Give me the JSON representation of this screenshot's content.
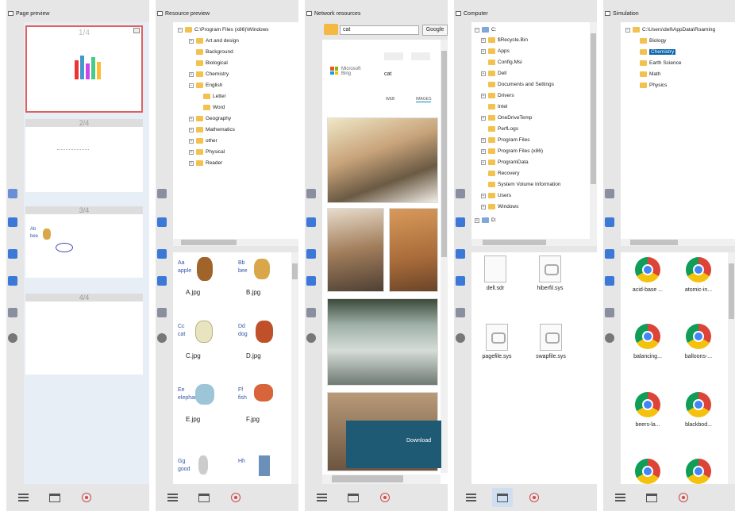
{
  "panels": {
    "page_preview": {
      "title": "Page preview",
      "pages": [
        "1/4",
        "2/4",
        "3/4",
        "4/4"
      ],
      "page3_text": {
        "line1": "Ab",
        "line2": "bee"
      }
    },
    "resource_preview": {
      "title": "Resource preview",
      "tree_root": "C:\\Program Files (x86)\\Windows",
      "tree": [
        "Art and design",
        "Background",
        "Biological",
        "Chemistry",
        "English",
        "Letter",
        "Word",
        "Geography",
        "Mathematics",
        "other",
        "Physical",
        "Reader"
      ],
      "items": [
        {
          "caption": "A.jpg",
          "word": "apple",
          "letter": "Aa"
        },
        {
          "caption": "B.jpg",
          "word": "bee",
          "letter": "Bb"
        },
        {
          "caption": "C.jpg",
          "word": "cat",
          "letter": "Cc"
        },
        {
          "caption": "D.jpg",
          "word": "dog",
          "letter": "Dd"
        },
        {
          "caption": "E.jpg",
          "word": "elephant",
          "letter": "Ee"
        },
        {
          "caption": "F.jpg",
          "word": "fish",
          "letter": "Ff"
        },
        {
          "word": "good",
          "letter": "Gg"
        },
        {
          "letter": "Hh"
        }
      ]
    },
    "network_resources": {
      "title": "Network resources",
      "search_value": "cat",
      "search_button": "Google",
      "bing_label": "Microsoft Bing",
      "bing_query": "cat",
      "tabs": [
        "WEB",
        "IMAGES"
      ],
      "download_label": "Download"
    },
    "computer": {
      "title": "Computer",
      "drive": "C:",
      "tree": [
        "$Recycle.Bin",
        "Apps",
        "Config.Msi",
        "Dell",
        "Documents and Settings",
        "Drivers",
        "Intel",
        "OneDriveTemp",
        "PerfLogs",
        "Program Files",
        "Program Files (x86)",
        "ProgramData",
        "Recovery",
        "System Volume Information",
        "Users",
        "Windows",
        "D:"
      ],
      "files": [
        "dell.sdr",
        "hiberfil.sys",
        "pagefile.sys",
        "swapfile.sys"
      ]
    },
    "simulation": {
      "title": "Simulation",
      "tree_root": "C:\\Users\\dell\\AppData\\Roaming",
      "tree": [
        "Biology",
        "Chemistry",
        "Earth Science",
        "Math",
        "Physics"
      ],
      "selected": "Chemistry",
      "items": [
        "acid-base ...",
        "atomic-in...",
        "balancing...",
        "balloons-...",
        "beers-la...",
        "blackbod..."
      ]
    }
  },
  "colors": {
    "selection": "#0a64ad",
    "accent": "#cfdff1",
    "page_border": "#e06060"
  }
}
